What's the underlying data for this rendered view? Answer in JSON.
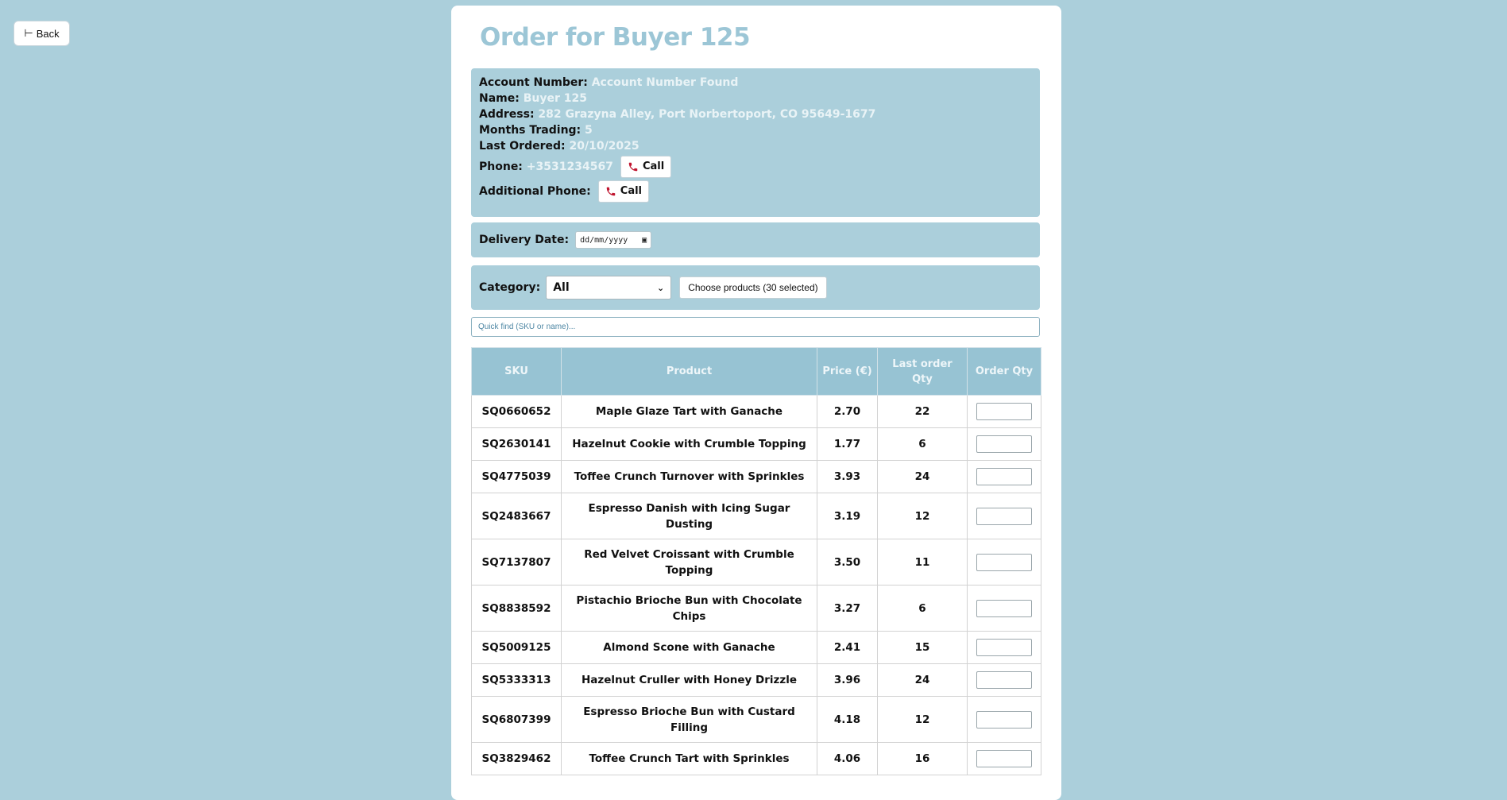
{
  "nav": {
    "back_label": "Back",
    "back_icon": "⊢"
  },
  "order": {
    "title": "Order for Buyer 125"
  },
  "account": {
    "account_number_label": "Account Number:",
    "account_number_value": "Account Number Found",
    "name_label": "Name:",
    "name_value": "Buyer 125",
    "address_label": "Address:",
    "address_value": "282 Grazyna Alley, Port Norbertoport, CO 95649-1677",
    "months_label": "Months Trading:",
    "months_value": "5",
    "last_ordered_label": "Last Ordered:",
    "last_ordered_value": "20/10/2025",
    "phone_label": "Phone:",
    "phone_value": "+3531234567",
    "additional_phone_label": "Additional Phone:",
    "call_label": "Call",
    "phone_icon_color": "#c0152f"
  },
  "delivery": {
    "label": "Delivery Date:",
    "placeholder": "dd/mm/yyyy"
  },
  "category": {
    "label": "Category:",
    "selected": "All",
    "choose_label": "Choose products (30 selected)"
  },
  "search": {
    "placeholder": "Quick find (SKU or name)..."
  },
  "table": {
    "headers": [
      "SKU",
      "Product",
      "Price (€)",
      "Last order Qty",
      "Order Qty"
    ],
    "rows": [
      {
        "sku": "SQ0660652",
        "product": "Maple Glaze Tart with Ganache",
        "price": "2.70",
        "last_qty": "22"
      },
      {
        "sku": "SQ2630141",
        "product": "Hazelnut Cookie with Crumble Topping",
        "price": "1.77",
        "last_qty": "6"
      },
      {
        "sku": "SQ4775039",
        "product": "Toffee Crunch Turnover with Sprinkles",
        "price": "3.93",
        "last_qty": "24"
      },
      {
        "sku": "SQ2483667",
        "product": "Espresso Danish with Icing Sugar Dusting",
        "price": "3.19",
        "last_qty": "12"
      },
      {
        "sku": "SQ7137807",
        "product": "Red Velvet Croissant with Crumble Topping",
        "price": "3.50",
        "last_qty": "11"
      },
      {
        "sku": "SQ8838592",
        "product": "Pistachio Brioche Bun with Chocolate Chips",
        "price": "3.27",
        "last_qty": "6"
      },
      {
        "sku": "SQ5009125",
        "product": "Almond Scone with Ganache",
        "price": "2.41",
        "last_qty": "15"
      },
      {
        "sku": "SQ5333313",
        "product": "Hazelnut Cruller with Honey Drizzle",
        "price": "3.96",
        "last_qty": "24"
      },
      {
        "sku": "SQ6807399",
        "product": "Espresso Brioche Bun with Custard Filling",
        "price": "4.18",
        "last_qty": "12"
      },
      {
        "sku": "SQ3829462",
        "product": "Toffee Crunch Tart with Sprinkles",
        "price": "4.06",
        "last_qty": "16"
      }
    ]
  },
  "colors": {
    "background": "#abcfdb",
    "title": "#9cc6d6",
    "header": "#97c3d3",
    "value_text": "#e9f3f6"
  }
}
